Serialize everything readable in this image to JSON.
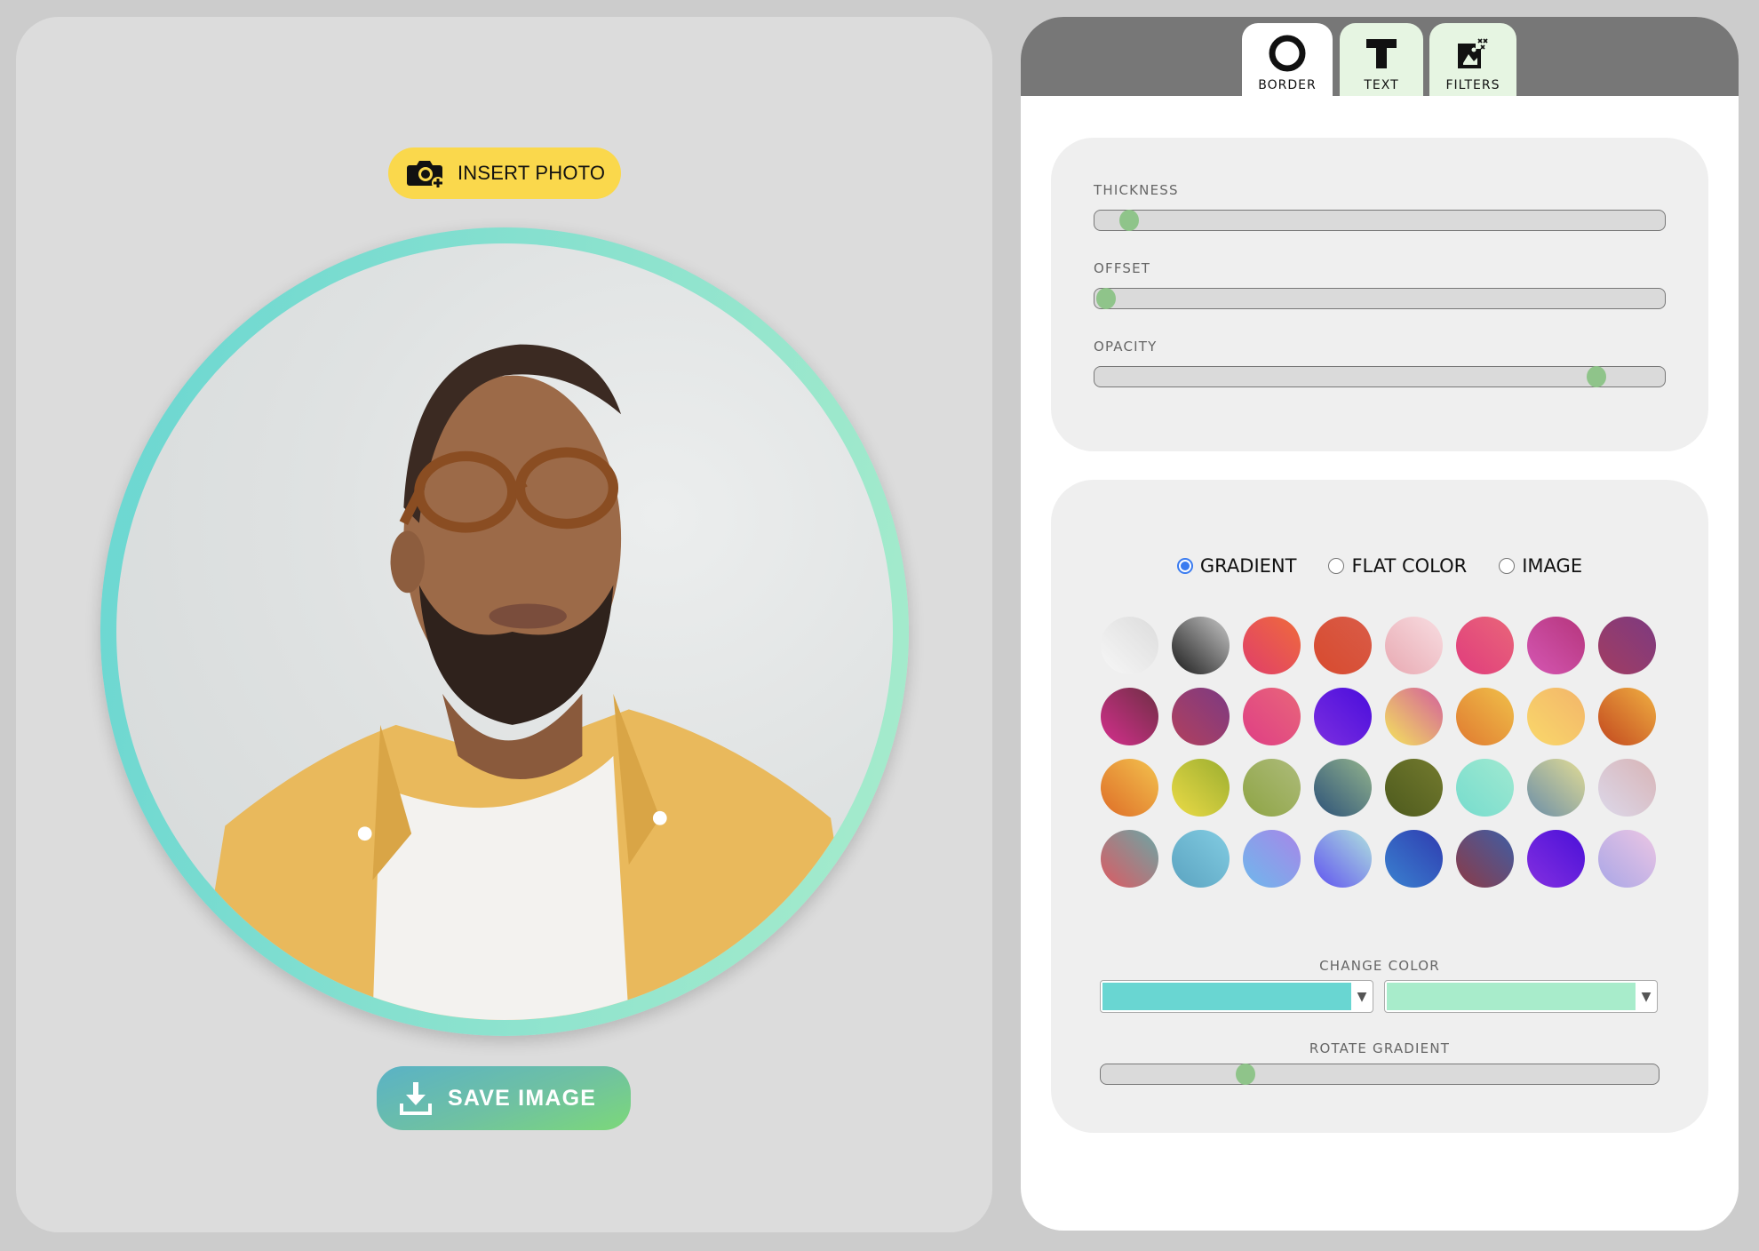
{
  "left": {
    "insert_button_label": "INSERT PHOTO",
    "insert_icon": "camera-plus-icon",
    "save_button_label": "SAVE IMAGE",
    "save_icon": "download-icon",
    "photo_alt": "Portrait of man with round glasses and yellow shirt",
    "border_gradient": [
      "#69d6d2",
      "#a8eccb"
    ]
  },
  "tabs": [
    {
      "label": "BORDER",
      "icon": "ring-icon",
      "active": true
    },
    {
      "label": "TEXT",
      "icon": "text-t-icon",
      "active": false
    },
    {
      "label": "FILTERS",
      "icon": "image-sparkle-icon",
      "active": false
    }
  ],
  "sliders": {
    "thickness": {
      "label": "THICKNESS",
      "value_percent": 6
    },
    "offset": {
      "label": "OFFSET",
      "value_percent": 2
    },
    "opacity": {
      "label": "OPACITY",
      "value_percent": 88
    }
  },
  "fill_mode": {
    "options": [
      {
        "label": "GRADIENT",
        "checked": true
      },
      {
        "label": "FLAT COLOR",
        "checked": false
      },
      {
        "label": "IMAGE",
        "checked": false
      }
    ]
  },
  "swatches": [
    [
      "#f7f7f7",
      "#dcdcdc"
    ],
    [
      "#1a1a1a",
      "#c8c8c8"
    ],
    [
      "#e03e6a",
      "#ef6b3c"
    ],
    [
      "#d84a2e",
      "#d95c48"
    ],
    [
      "#e8a9b2",
      "#f8dde1"
    ],
    [
      "#e03c7c",
      "#e9667a"
    ],
    [
      "#d557b3",
      "#b5357c"
    ],
    [
      "#a23d62",
      "#7d3a80"
    ],
    [
      "#d52f8d",
      "#6e2f44"
    ],
    [
      "#b2405e",
      "#7c3a82"
    ],
    [
      "#df3e85",
      "#e8667a"
    ],
    [
      "#7c2fe0",
      "#4a0ddc"
    ],
    [
      "#f4e55c",
      "#d35e9c"
    ],
    [
      "#e07a30",
      "#f0c04a"
    ],
    [
      "#f9d86a",
      "#f3b56a"
    ],
    [
      "#c2471e",
      "#f0b042"
    ],
    [
      "#de6d27",
      "#f3c24e"
    ],
    [
      "#ecdb46",
      "#9bae30"
    ],
    [
      "#8ea444",
      "#adbb7a"
    ],
    [
      "#2c5178",
      "#93b48d"
    ],
    [
      "#4d5a1d",
      "#737a2e"
    ],
    [
      "#76dcce",
      "#a0e9d0"
    ],
    [
      "#6b8ea8",
      "#e2dc95"
    ],
    [
      "#dcd8ea",
      "#d8b4b6"
    ],
    [
      "#de5962",
      "#6aa7a6"
    ],
    [
      "#5ba3c0",
      "#82cce2"
    ],
    [
      "#6eb8ec",
      "#a786e8"
    ],
    [
      "#5f52f0",
      "#b0e2de"
    ],
    [
      "#3a82d0",
      "#2f3cb0"
    ],
    [
      "#8d3a46",
      "#3e5ea6"
    ],
    [
      "#8430e0",
      "#4a10d8"
    ],
    [
      "#a9a6e6",
      "#ecc6e4"
    ]
  ],
  "change_color": {
    "label": "CHANGE COLOR",
    "color_a": "#69d6d2",
    "color_b": "#a8eccb",
    "arrow": "▼"
  },
  "rotate_gradient": {
    "label": "ROTATE GRADIENT",
    "value_percent": 26
  }
}
